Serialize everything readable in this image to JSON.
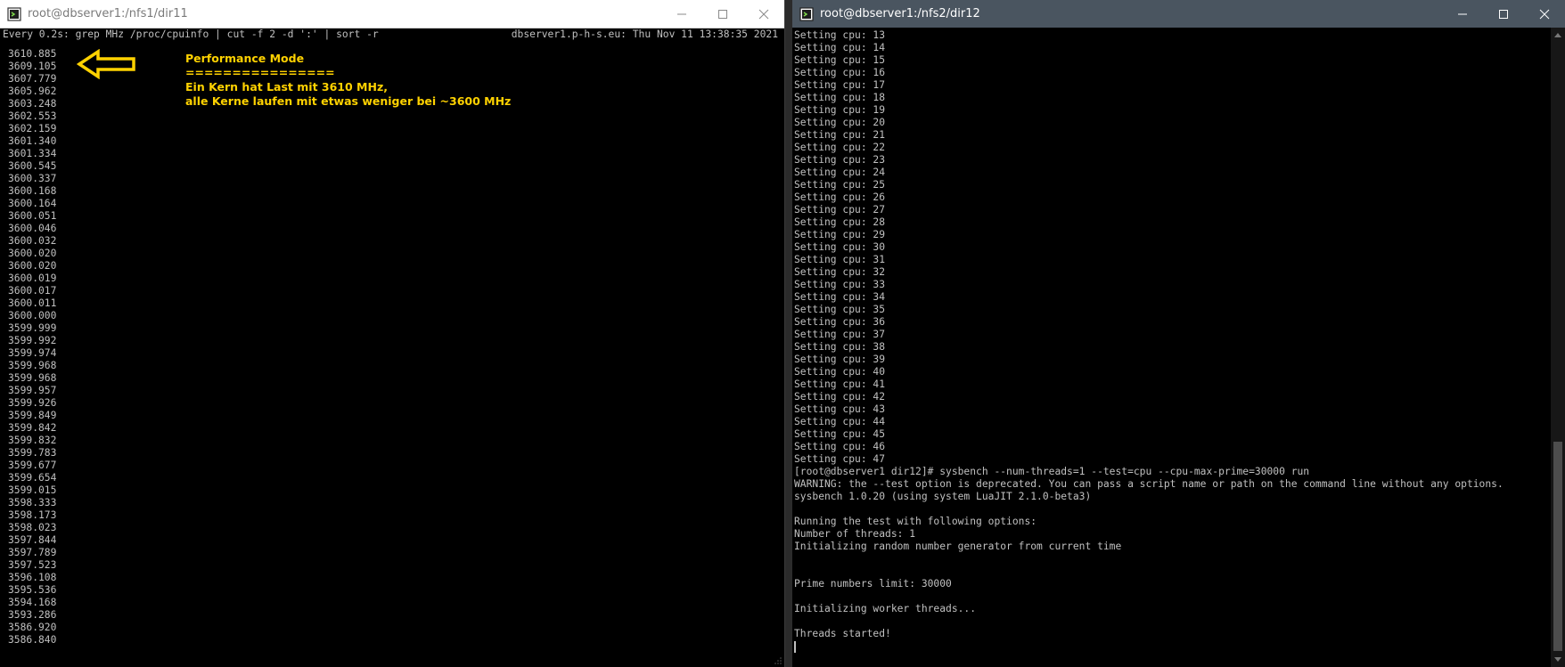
{
  "left_window": {
    "title": "root@dbserver1:/nfs1/dir11",
    "icon": "terminal-icon",
    "header_command": "Every 0.2s: grep MHz /proc/cpuinfo | cut -f 2 -d ':' | sort -r",
    "header_host_time": "dbserver1.p-h-s.eu: Thu Nov 11 13:38:35 2021",
    "values": [
      "3610.885",
      "3609.105",
      "3607.779",
      "3605.962",
      "3603.248",
      "3602.553",
      "3602.159",
      "3601.340",
      "3601.334",
      "3600.545",
      "3600.337",
      "3600.168",
      "3600.164",
      "3600.051",
      "3600.046",
      "3600.032",
      "3600.020",
      "3600.020",
      "3600.019",
      "3600.017",
      "3600.011",
      "3600.000",
      "3599.999",
      "3599.992",
      "3599.974",
      "3599.968",
      "3599.968",
      "3599.957",
      "3599.926",
      "3599.849",
      "3599.842",
      "3599.832",
      "3599.783",
      "3599.677",
      "3599.654",
      "3599.015",
      "3598.333",
      "3598.173",
      "3598.023",
      "3597.844",
      "3597.789",
      "3597.523",
      "3596.108",
      "3595.536",
      "3594.168",
      "3593.286",
      "3586.920",
      "3586.840"
    ],
    "annotation": {
      "title": "Performance Mode",
      "underline": "================",
      "line1": "Ein Kern hat Last mit 3610 MHz,",
      "line2": "alle Kerne laufen mit etwas weniger bei ~3600 MHz",
      "color": "#ffd200"
    }
  },
  "right_window": {
    "title": "root@dbserver1:/nfs2/dir12",
    "icon": "terminal-icon",
    "lines": [
      "Setting cpu: 13",
      "Setting cpu: 14",
      "Setting cpu: 15",
      "Setting cpu: 16",
      "Setting cpu: 17",
      "Setting cpu: 18",
      "Setting cpu: 19",
      "Setting cpu: 20",
      "Setting cpu: 21",
      "Setting cpu: 22",
      "Setting cpu: 23",
      "Setting cpu: 24",
      "Setting cpu: 25",
      "Setting cpu: 26",
      "Setting cpu: 27",
      "Setting cpu: 28",
      "Setting cpu: 29",
      "Setting cpu: 30",
      "Setting cpu: 31",
      "Setting cpu: 32",
      "Setting cpu: 33",
      "Setting cpu: 34",
      "Setting cpu: 35",
      "Setting cpu: 36",
      "Setting cpu: 37",
      "Setting cpu: 38",
      "Setting cpu: 39",
      "Setting cpu: 40",
      "Setting cpu: 41",
      "Setting cpu: 42",
      "Setting cpu: 43",
      "Setting cpu: 44",
      "Setting cpu: 45",
      "Setting cpu: 46",
      "Setting cpu: 47",
      "[root@dbserver1 dir12]# sysbench --num-threads=1 --test=cpu --cpu-max-prime=30000 run",
      "WARNING: the --test option is deprecated. You can pass a script name or path on the command line without any options.",
      "sysbench 1.0.20 (using system LuaJIT 2.1.0-beta3)",
      "",
      "Running the test with following options:",
      "Number of threads: 1",
      "Initializing random number generator from current time",
      "",
      "",
      "Prime numbers limit: 30000",
      "",
      "Initializing worker threads...",
      "",
      "Threads started!",
      ""
    ]
  }
}
